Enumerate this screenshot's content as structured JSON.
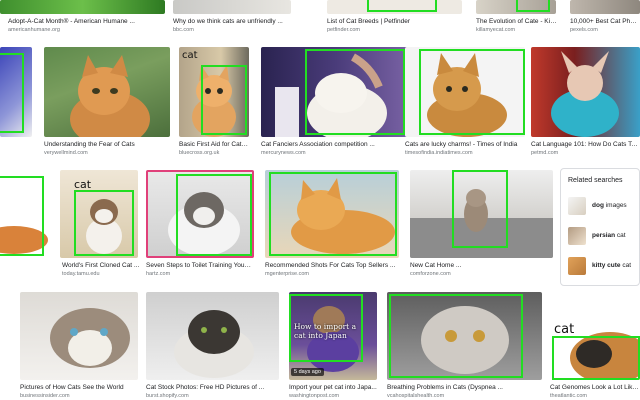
{
  "row0": [
    {
      "title": "Adopt-A-Cat Month® - American Humane ...",
      "source": "americanhumane.org"
    },
    {
      "title": "Why do we think cats are unfriendly ...",
      "source": "bbc.com"
    },
    {
      "title": "List of Cat Breeds | Petfinder",
      "source": "petfinder.com"
    },
    {
      "title": "The Evolution of Cate - Killa...",
      "source": "killamyecat.com"
    },
    {
      "title": "10,000+ Best Cat Phot...",
      "source": "pexels.com"
    }
  ],
  "row1": [
    {
      "title": "Understanding the Fear of Cats",
      "source": "verywellmind.com"
    },
    {
      "title": "Basic First Aid for Cats ...",
      "source": "bluecross.org.uk"
    },
    {
      "title": "Cat Fanciers Association competition ...",
      "source": "mercurynews.com"
    },
    {
      "title": "Cats are lucky charms! - Times of India",
      "source": "timesofindia.indiatimes.com"
    },
    {
      "title": "Cat Language 101: How Do Cats Talk t...",
      "source": "petmd.com"
    }
  ],
  "row2": [
    {
      "title": "World's First Cloned Cat ...",
      "source": "today.tamu.edu"
    },
    {
      "title": "Seven Steps to Toilet Training Your ...",
      "source": "hartz.com"
    },
    {
      "title": "Recommended Shots For Cats Top Sellers ...",
      "source": "mgenterprise.com"
    },
    {
      "title": "New Cat Home ...",
      "source": "comforzone.com"
    }
  ],
  "row3": [
    {
      "title": "Pictures of How Cats See the World",
      "source": "businessinsider.com"
    },
    {
      "title": "Cat Stock Photos: Free HD Pictures of ...",
      "source": "burst.shopify.com"
    },
    {
      "title": "Import your pet cat into Japa...",
      "source": "washingtonpost.com"
    },
    {
      "title": "Breathing Problems in Cats (Dyspnea ...",
      "source": "vcahospitalshealth.com"
    },
    {
      "title": "Cat Genomes Look a Lot Like ...",
      "source": "theatlantic.com"
    }
  ],
  "overlays": {
    "cat_label_small": "cat",
    "cat_label_corner": "cat",
    "how_to_import": "How to import a cat into Japan",
    "days_ago": "5 days ago"
  },
  "related": {
    "title": "Related searches",
    "items": [
      {
        "bold": "dog",
        "rest": " images"
      },
      {
        "bold": "",
        "rest": "persian cat"
      },
      {
        "bold": "kitty cute",
        "rest": " cat"
      }
    ],
    "item2_bold_tail": "persian"
  },
  "colors": {
    "bbox": "#22dd22",
    "pink_frame": "#e0407a",
    "link": "#1a0dab",
    "muted": "#70757a"
  }
}
